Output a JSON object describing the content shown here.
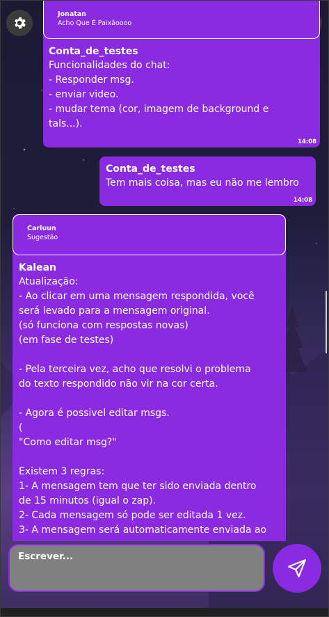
{
  "header": {
    "settings_icon": "gear-icon",
    "people_icon": "group-icon"
  },
  "messages": [
    {
      "reply": {
        "author": "Jonatan",
        "text": "Acho Que É Paixãoooo"
      },
      "author": "Conta_de_testes",
      "text": "Funcionalidades do chat:\n- Responder msg.\n- enviar video.\n- mudar tema (cor, imagem de background e\ntals...).",
      "time": "14:08"
    },
    {
      "author": "Conta_de_testes",
      "text": "Tem mais coisa, mas eu não me lembro",
      "time": "14:08"
    },
    {
      "reply": {
        "author": "Carluun",
        "text": "Sugestão"
      },
      "author": "Kalean",
      "text": "Atualização:\n- Ao clicar em uma mensagem respondida, você\nserá levado para a mensagem original.\n(só funciona com respostas novas)\n(em fase de testes)\n\n- Pela terceira vez, acho que resolvi o problema\ndo texto respondido não vir na cor certa.\n\n- Agora é possivel editar msgs.\n(\n\"Como editar msg?\"\n\nExistem 3 regras:\n1- A mensagem tem que ter sido enviada dentro\nde 15 minutos (igual o zap).\n2- Cada mensagem só pode ser editada 1 vez.\n3- A mensagem será automaticamente enviada ao"
    }
  ],
  "composer": {
    "placeholder": "Escrever...",
    "send_icon": "send-icon"
  },
  "colors": {
    "accent": "#8a2be2",
    "composer_bg": "#808080",
    "icon_button_bg": "#3b3b3b"
  }
}
